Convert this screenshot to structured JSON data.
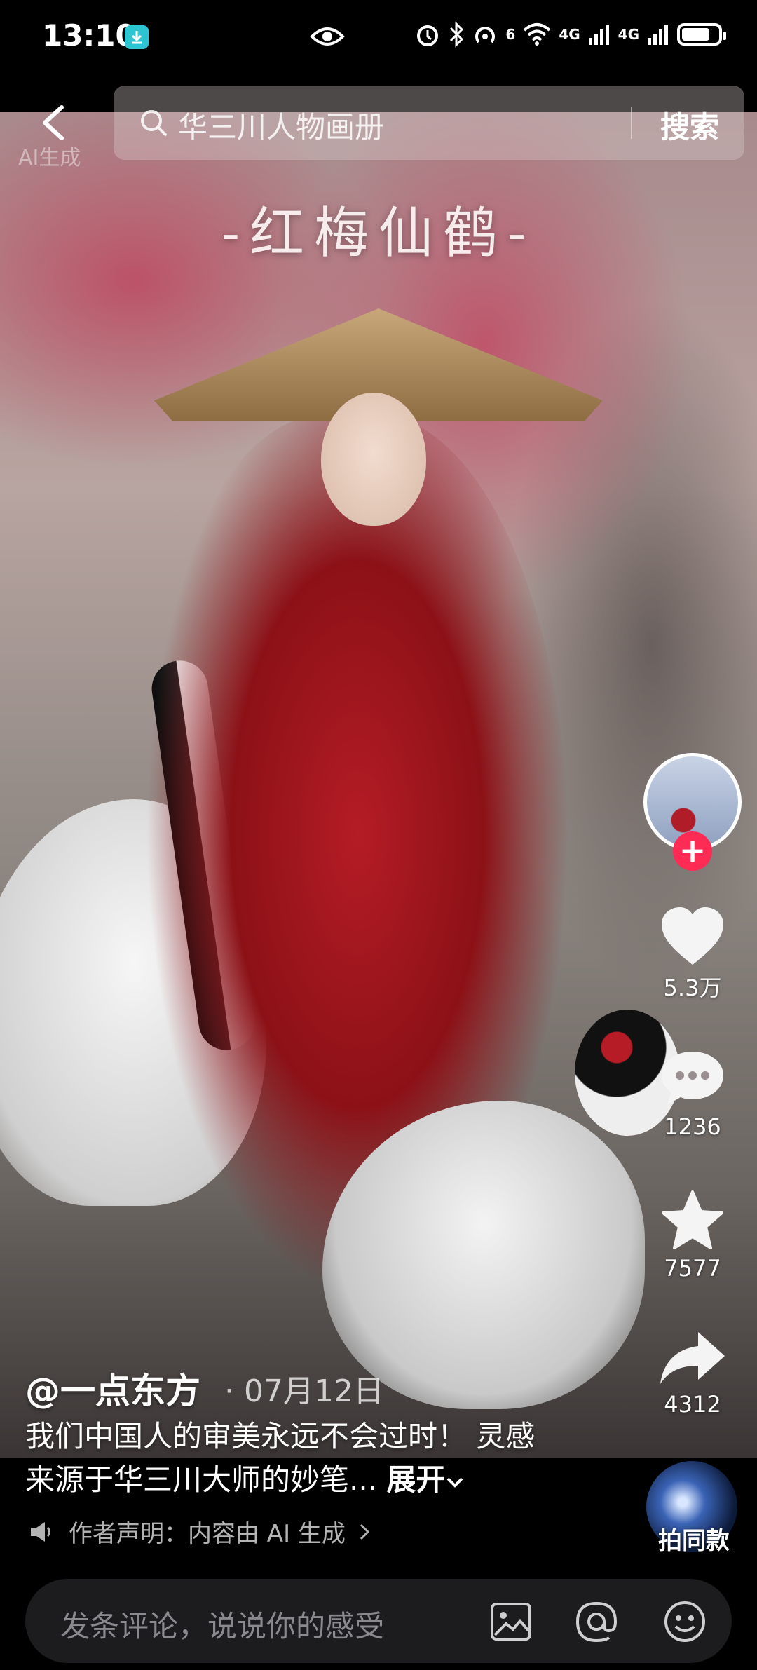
{
  "status_bar": {
    "time": "13:10",
    "signal1": "4G",
    "signal2": "4G",
    "wifi_badge": "6",
    "battery_level": 0.8
  },
  "search": {
    "placeholder": "华三川人物画册",
    "button_label": "搜索"
  },
  "video": {
    "overlay_title": "-红梅仙鹤-",
    "watermark": "AI生成"
  },
  "actions": {
    "likes": "5.3万",
    "comments": "1236",
    "favorites": "7577",
    "shares": "4312"
  },
  "post": {
    "author": "@一点东方",
    "date": "07月12日",
    "caption": "我们中国人的审美永远不会过时！ 灵感来源于华三川大师的妙笔...",
    "expand_label": "展开",
    "disclaimer": "作者声明：内容由 AI 生成"
  },
  "same_style": {
    "label": "拍同款"
  },
  "comment_bar": {
    "placeholder": "发条评论，说说你的感受"
  },
  "colors": {
    "accent_follow": "#fe2c55",
    "comment_bar_bg": "#1c1c1e"
  }
}
